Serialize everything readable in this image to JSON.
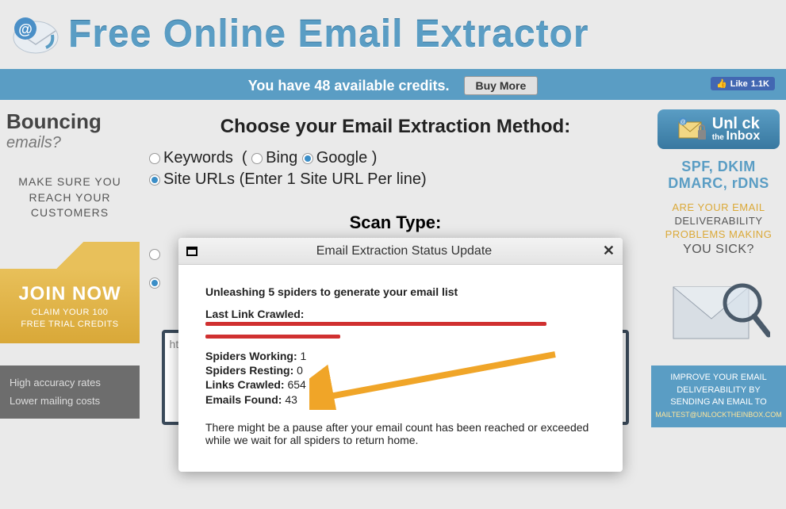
{
  "header": {
    "title": "Free Online Email Extractor"
  },
  "credits": {
    "text": "You have 48 available credits.",
    "buy_more_label": "Buy More",
    "like_label": "Like",
    "like_count": "1.1K"
  },
  "sidebar_left": {
    "bouncing": "Bouncing",
    "emails_q": "emails?",
    "makesure": "MAKE SURE YOU REACH YOUR CUSTOMERS",
    "join_title": "JOIN NOW",
    "join_sub1": "CLAIM YOUR 100",
    "join_sub2": "FREE TRIAL CREDITS",
    "benefits": [
      "High accuracy rates",
      "Lower mailing costs"
    ]
  },
  "main": {
    "choose_title": "Choose your Email Extraction Method:",
    "keywords_label": "Keywords",
    "bing_label": "Bing",
    "google_label": "Google",
    "siteurls_label": "Site URLs (Enter 1 Site URL Per line)",
    "scan_title": "Scan Type:",
    "url_placeholder": "http"
  },
  "sidebar_right": {
    "unlock": "Unl  ck",
    "inbox_small": "the",
    "inbox": "Inbox",
    "dkim_line1": "SPF, DKIM",
    "dkim_line2": "DMARC, rDNS",
    "sick_prefix": "ARE YOUR EMAIL",
    "sick_deliv": "DELIVERABILITY",
    "sick_prob": "PROBLEMS MAKING",
    "sick_you": "YOU SICK?",
    "improve": "IMPROVE YOUR EMAIL",
    "improve2": "DELIVERABILITY BY",
    "improve3": "SENDING AN EMAIL TO",
    "improve_email": "MAILTEST@UNLOCKTHEINBOX.COM"
  },
  "modal": {
    "title": "Email Extraction Status Update",
    "unleashing": "Unleashing 5 spiders to generate your email list",
    "last_link_label": "Last Link Crawled:",
    "spiders_working_label": "Spiders Working:",
    "spiders_working_value": "1",
    "spiders_resting_label": "Spiders Resting:",
    "spiders_resting_value": "0",
    "links_crawled_label": "Links Crawled:",
    "links_crawled_value": "654",
    "emails_found_label": "Emails Found:",
    "emails_found_value": "43",
    "pause_note": "There might be a pause after your email count has been reached or exceeded while we wait for all spiders to return home."
  }
}
